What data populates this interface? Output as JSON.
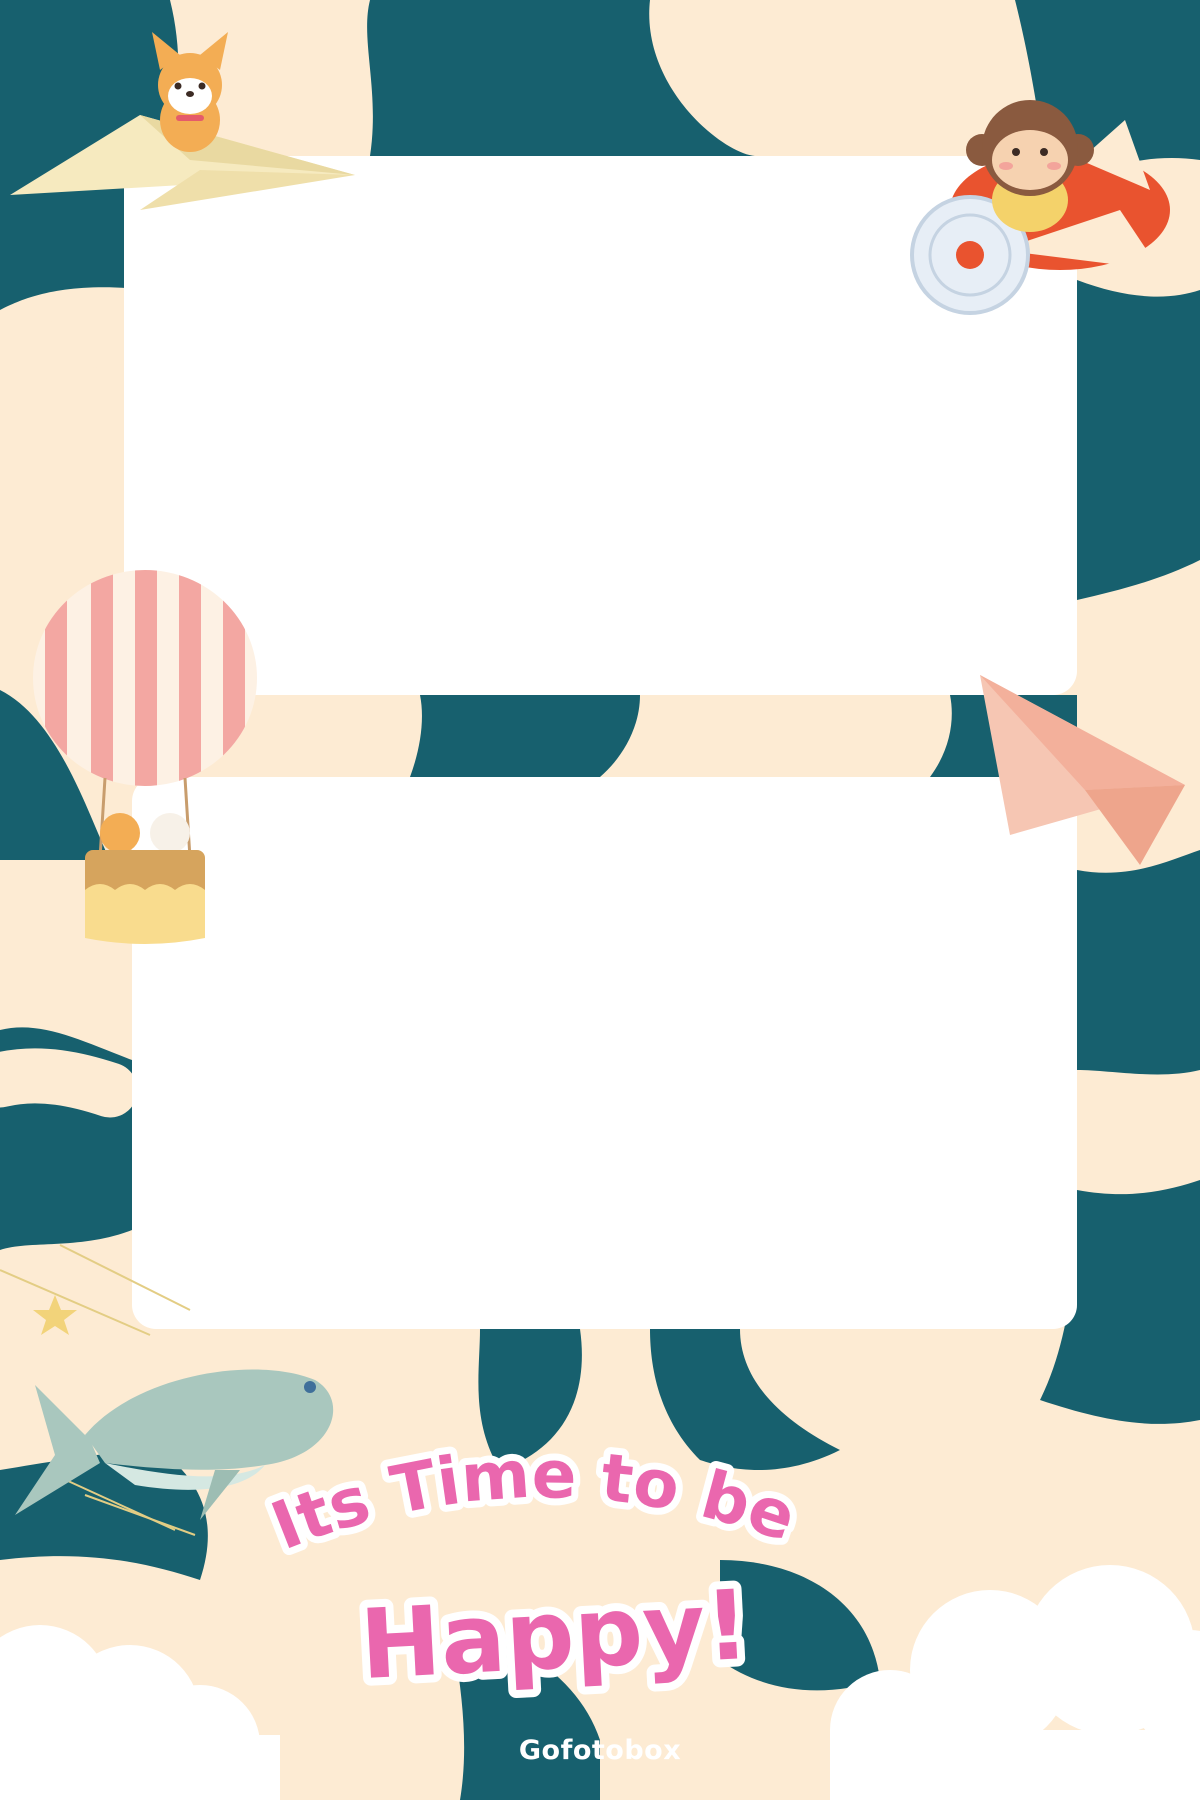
{
  "colors": {
    "background_cream": "#fdebd3",
    "background_teal": "#17606e",
    "slot_white": "#ffffff",
    "headline_pink": "#ea67ae",
    "headline_outline": "#ffffff",
    "balloon_pink": "#f3a7a2",
    "balloon_cream": "#fdf1e4",
    "whale": "#a9c7be"
  },
  "photo_slots": [
    {
      "label": "",
      "content": "empty"
    },
    {
      "label": "",
      "content": "empty"
    }
  ],
  "headline": {
    "line1": "Its Time to be",
    "line2": "Happy!"
  },
  "brand": "Gofotobox",
  "decorations": [
    "paper-plane-with-dog-icon",
    "monkey-airplane-icon",
    "hot-air-balloon-icon",
    "paper-plane-icon",
    "star-icon",
    "whale-icon",
    "cloud-icon"
  ]
}
